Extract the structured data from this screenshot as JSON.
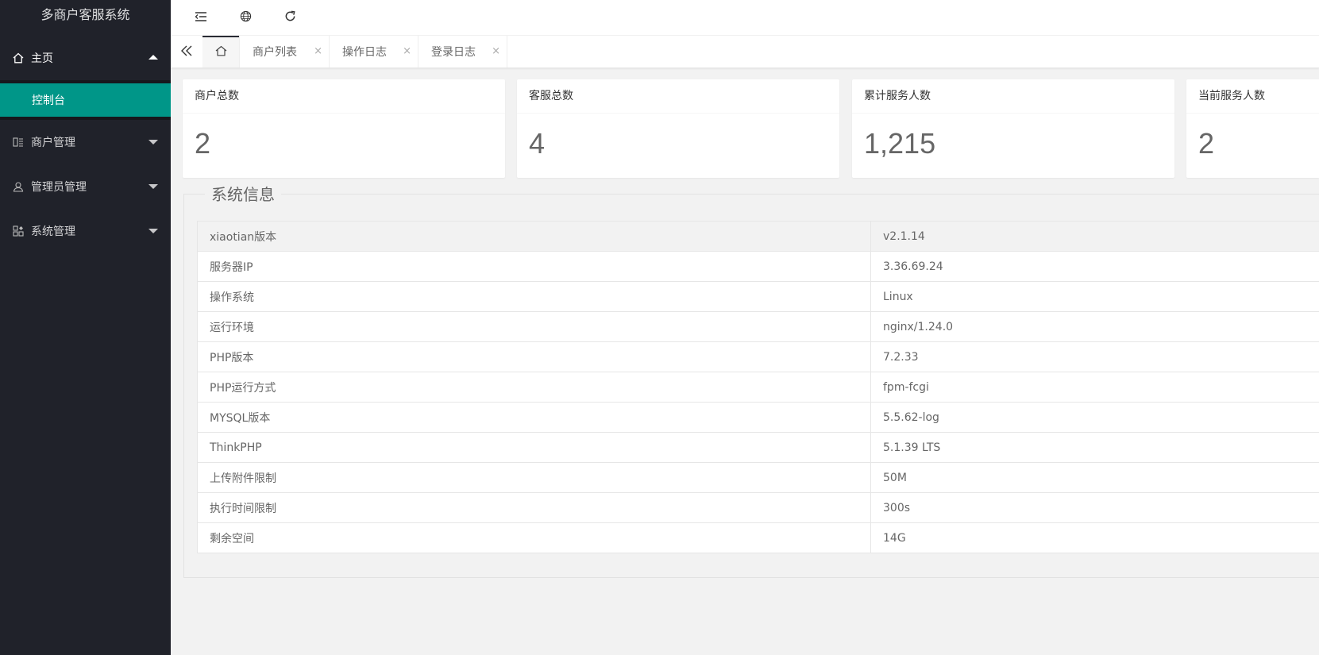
{
  "app": {
    "title": "多商户客服系统"
  },
  "sidebar": {
    "items": [
      {
        "label": "主页",
        "icon": "home-icon",
        "expanded": true,
        "children": [
          {
            "label": "控制台",
            "active": true
          }
        ]
      },
      {
        "label": "商户管理",
        "icon": "merchant-icon",
        "expanded": false
      },
      {
        "label": "管理员管理",
        "icon": "user-icon",
        "expanded": false
      },
      {
        "label": "系统管理",
        "icon": "apps-icon",
        "expanded": false
      }
    ]
  },
  "header": {
    "buttons": [
      "menu-toggle-icon",
      "globe-icon",
      "refresh-icon"
    ]
  },
  "tabs": [
    {
      "label": "",
      "icon": "home-icon",
      "active": true
    },
    {
      "label": "商户列表",
      "close": "×"
    },
    {
      "label": "操作日志",
      "close": "×"
    },
    {
      "label": "登录日志",
      "close": "×"
    }
  ],
  "stats": [
    {
      "title": "商户总数",
      "value": "2"
    },
    {
      "title": "客服总数",
      "value": "4"
    },
    {
      "title": "累计服务人数",
      "value": "1,215"
    },
    {
      "title": "当前服务人数",
      "value": "2"
    }
  ],
  "system_info": {
    "title": "系统信息",
    "rows": [
      {
        "key": "xiaotian版本",
        "value": "v2.1.14"
      },
      {
        "key": "服务器IP",
        "value": "3.36.69.24"
      },
      {
        "key": "操作系统",
        "value": "Linux"
      },
      {
        "key": "运行环境",
        "value": "nginx/1.24.0"
      },
      {
        "key": "PHP版本",
        "value": "7.2.33"
      },
      {
        "key": "PHP运行方式",
        "value": "fpm-fcgi"
      },
      {
        "key": "MYSQL版本",
        "value": "5.5.62-log"
      },
      {
        "key": "ThinkPHP",
        "value": "5.1.39 LTS"
      },
      {
        "key": "上传附件限制",
        "value": "50M"
      },
      {
        "key": "执行时间限制",
        "value": "300s"
      },
      {
        "key": "剩余空间",
        "value": "14G"
      }
    ]
  },
  "colors": {
    "sidebar": "#20222a",
    "accent": "#009688",
    "background": "#f2f2f2"
  }
}
